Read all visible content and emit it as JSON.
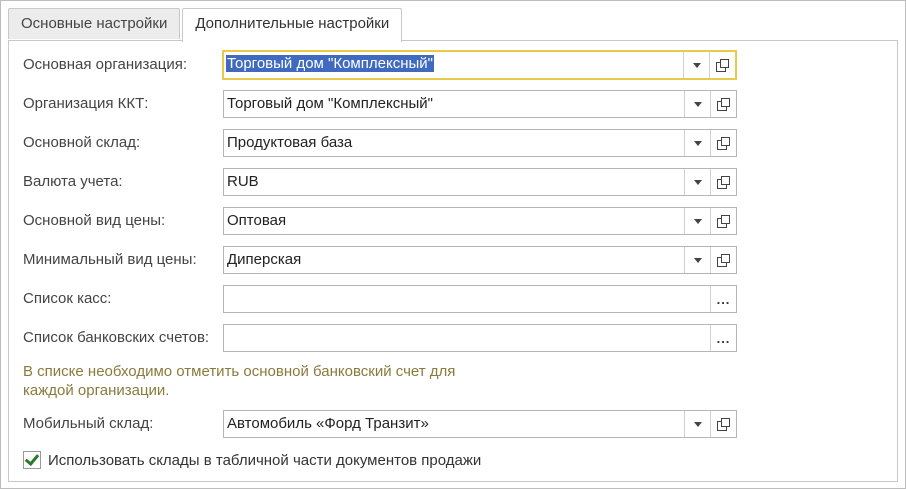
{
  "tabs": [
    {
      "label": "Основные настройки",
      "active": false
    },
    {
      "label": "Дополнительные настройки",
      "active": true
    }
  ],
  "fields": {
    "org": {
      "label": "Основная организация:",
      "value": "Торговый дом \"Комплексный\""
    },
    "kkt": {
      "label": "Организация ККТ:",
      "value": "Торговый дом \"Комплексный\""
    },
    "warehouse": {
      "label": "Основной склад:",
      "value": "Продуктовая база"
    },
    "currency": {
      "label": "Валюта учета:",
      "value": "RUB"
    },
    "price_type": {
      "label": "Основной вид цены:",
      "value": "Оптовая"
    },
    "min_price_type": {
      "label": "Минимальный вид цены:",
      "value": "Диперская"
    },
    "cashboxes": {
      "label": "Список касс:",
      "value": ""
    },
    "bank_accounts": {
      "label": "Список банковских счетов:",
      "value": ""
    },
    "mobile_warehouse": {
      "label": "Мобильный склад:",
      "value": "Автомобиль «Форд Транзит»"
    }
  },
  "hint": "В списке необходимо отметить основной банковский счет для каждой организации.",
  "use_warehouses": {
    "label": "Использовать склады в табличной части документов продажи",
    "checked": true
  },
  "buttons": {
    "more": "...",
    "dropdown_icon": "triangle-down-icon",
    "open_icon": "open-form-icon"
  },
  "colors": {
    "focus_border": "#e9c94a",
    "selection": "#3f6ac0",
    "hint": "#8a7a3c",
    "check": "#2a7a2a"
  }
}
